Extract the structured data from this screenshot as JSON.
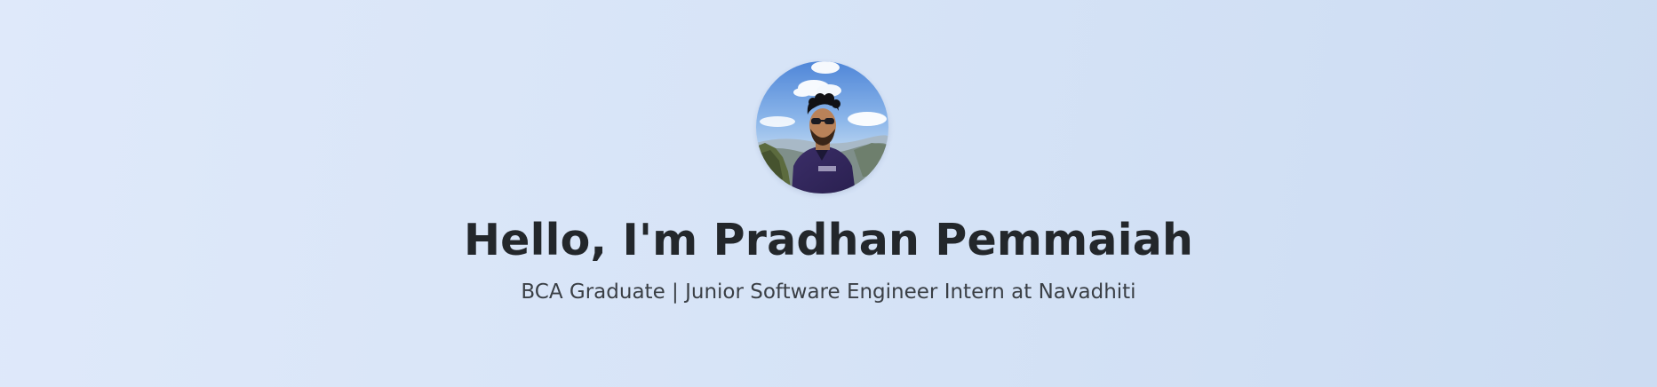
{
  "hero": {
    "avatar_icon": "profile-photo",
    "title": "Hello, I'm Pradhan Pemmaiah",
    "subtitle": "BCA Graduate | Junior Software Engineer Intern at Navadhiti"
  },
  "colors": {
    "background_start": "#dfe9fa",
    "background_end": "#ccdcf2",
    "title_text": "#23272b",
    "subtitle_text": "#3a3f45"
  }
}
